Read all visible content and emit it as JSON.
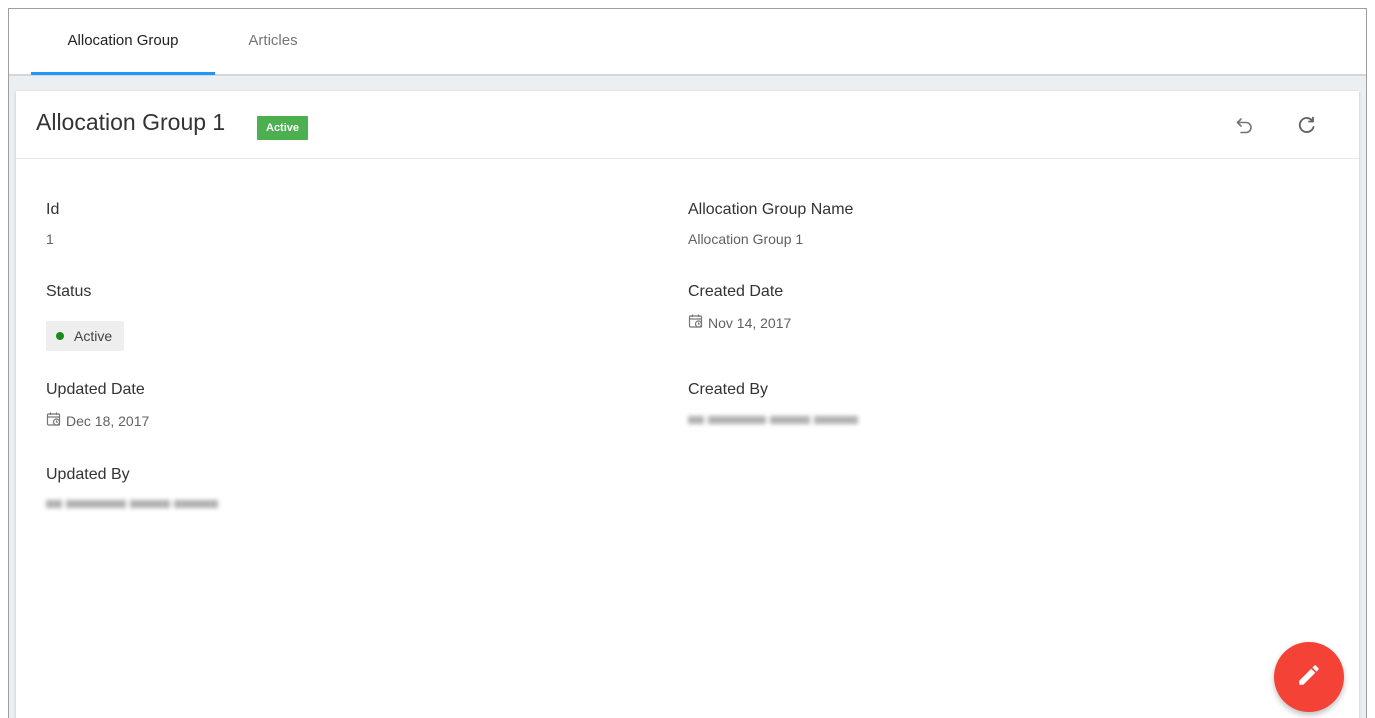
{
  "tabs": [
    {
      "label": "Allocation Group",
      "active": true
    },
    {
      "label": "Articles",
      "active": false
    }
  ],
  "card": {
    "title": "Allocation Group 1",
    "status_badge": "Active",
    "undo_icon": "undo-icon",
    "refresh_icon": "refresh-icon"
  },
  "fields": {
    "id": {
      "label": "Id",
      "value": "1"
    },
    "name": {
      "label": "Allocation Group Name",
      "value": "Allocation Group 1"
    },
    "status": {
      "label": "Status",
      "value": "Active"
    },
    "created_date": {
      "label": "Created Date",
      "value": "Nov 14, 2017"
    },
    "updated_date": {
      "label": "Updated Date",
      "value": "Dec 18, 2017"
    },
    "created_by": {
      "label": "Created By"
    },
    "updated_by": {
      "label": "Updated By"
    }
  },
  "fab": {
    "icon": "edit-icon"
  },
  "colors": {
    "accent": "#2196f3",
    "badge": "#4caf50",
    "status_dot": "#1b8a1b",
    "fab": "#f44336"
  }
}
